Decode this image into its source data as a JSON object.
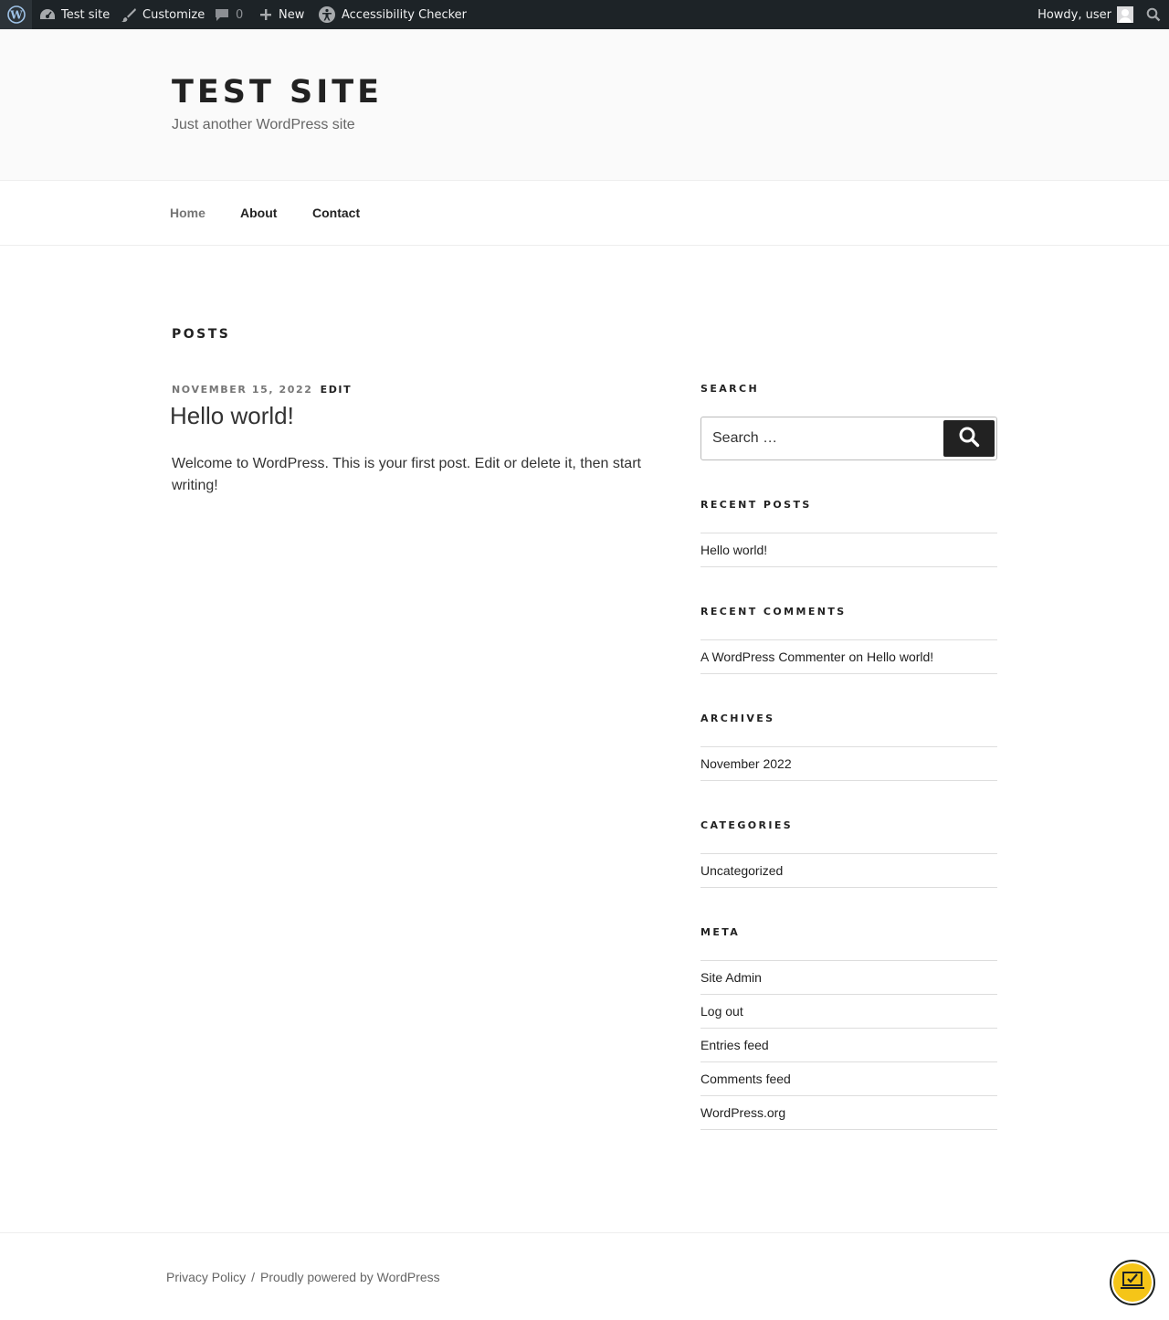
{
  "adminbar": {
    "site_name": "Test site",
    "customize": "Customize",
    "comments_count": "0",
    "new": "New",
    "accessibility": "Accessibility Checker",
    "howdy": "Howdy, user"
  },
  "header": {
    "title": "TEST SITE",
    "tagline": "Just another WordPress site"
  },
  "nav": {
    "items": [
      "Home",
      "About",
      "Contact"
    ]
  },
  "main": {
    "page_title": "POSTS",
    "post": {
      "date": "NOVEMBER 15, 2022",
      "edit": "EDIT",
      "title": "Hello world!",
      "body": "Welcome to WordPress. This is your first post. Edit or delete it, then start writing!"
    }
  },
  "sidebar": {
    "search": {
      "title": "SEARCH",
      "placeholder": "Search …"
    },
    "recent_posts": {
      "title": "RECENT POSTS",
      "items": [
        "Hello world!"
      ]
    },
    "recent_comments": {
      "title": "RECENT COMMENTS",
      "author": "A WordPress Commenter",
      "on": "on",
      "post": "Hello world!"
    },
    "archives": {
      "title": "ARCHIVES",
      "items": [
        "November 2022"
      ]
    },
    "categories": {
      "title": "CATEGORIES",
      "items": [
        "Uncategorized"
      ]
    },
    "meta": {
      "title": "META",
      "items": [
        "Site Admin",
        "Log out",
        "Entries feed",
        "Comments feed",
        "WordPress.org"
      ]
    }
  },
  "footer": {
    "privacy": "Privacy Policy",
    "separator": "/",
    "powered": "Proudly powered by WordPress"
  },
  "colors": {
    "adminbar_bg": "#1d2327",
    "badge": "#f5c518"
  }
}
